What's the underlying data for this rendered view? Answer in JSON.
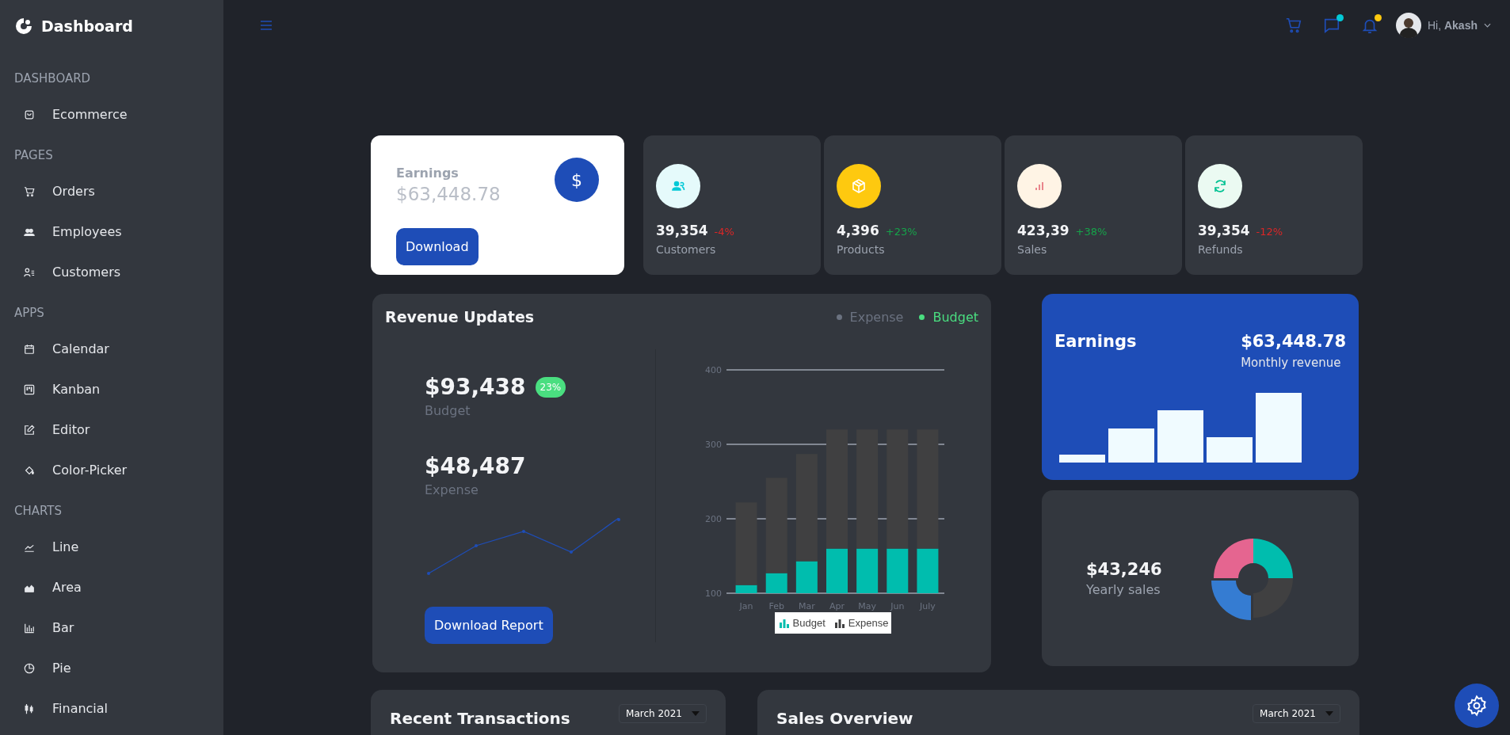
{
  "sidebar": {
    "brand": "Dashboard",
    "sections": [
      {
        "title": "DASHBOARD",
        "items": [
          {
            "label": "Ecommerce",
            "kind": "bag"
          }
        ]
      },
      {
        "title": "PAGES",
        "items": [
          {
            "label": "Orders",
            "kind": "cart"
          },
          {
            "label": "Employees",
            "kind": "users"
          },
          {
            "label": "Customers",
            "kind": "userlist"
          }
        ]
      },
      {
        "title": "APPS",
        "items": [
          {
            "label": "Calendar",
            "kind": "calendar"
          },
          {
            "label": "Kanban",
            "kind": "kanban"
          },
          {
            "label": "Editor",
            "kind": "edit"
          },
          {
            "label": "Color-Picker",
            "kind": "bucket"
          }
        ]
      },
      {
        "title": "CHARTS",
        "items": [
          {
            "label": "Line",
            "kind": "line"
          },
          {
            "label": "Area",
            "kind": "area"
          },
          {
            "label": "Bar",
            "kind": "bar"
          },
          {
            "label": "Pie",
            "kind": "pie"
          },
          {
            "label": "Financial",
            "kind": "financial"
          }
        ]
      }
    ]
  },
  "topbar": {
    "actions": [
      {
        "kind": "cart"
      },
      {
        "kind": "chat",
        "color": "#03c9d7"
      },
      {
        "kind": "bell",
        "color": "#fec90f"
      }
    ],
    "user": {
      "greeting": "Hi,",
      "name": "Akash"
    }
  },
  "earnings_card": {
    "title": "Earnings",
    "amount": "$63,448.78",
    "symbol": "$",
    "button": "Download"
  },
  "stats": [
    {
      "kind": "customers",
      "color": "#e5fafb",
      "value": "39,354",
      "change": {
        "text": "-4%",
        "color": "#dc2626"
      },
      "label": "Customers"
    },
    {
      "kind": "products",
      "color": "#fec90f",
      "value": "4,396",
      "change": {
        "text": "+23%",
        "color": "#16a34a"
      },
      "label": "Products"
    },
    {
      "kind": "sales",
      "color": "#fff4e5",
      "value": "423,39",
      "change": {
        "text": "+38%",
        "color": "#16a34a"
      },
      "label": "Sales"
    },
    {
      "kind": "refunds",
      "color": "#ebfaf2",
      "value": "39,354",
      "change": {
        "text": "-12%",
        "color": "#dc2626"
      },
      "label": "Refunds"
    }
  ],
  "revenue": {
    "title": "Revenue Updates",
    "legend": [
      {
        "label": "Expense",
        "selected": false
      },
      {
        "label": "Budget",
        "selected": true
      }
    ],
    "budget": {
      "amount": "$93,438",
      "badge": "23%",
      "label": "Budget"
    },
    "expense": {
      "amount": "$48,487",
      "label": "Expense"
    },
    "button": "Download Report",
    "chart_data": {
      "type": "bar",
      "stacked": true,
      "legend": "bottom",
      "categories": [
        "Jan",
        "Feb",
        "Mar",
        "Apr",
        "May",
        "Jun",
        "July"
      ],
      "ylim": [
        100,
        400
      ],
      "yticks": [
        100,
        200,
        300,
        400
      ],
      "series": [
        {
          "name": "Budget",
          "color": "#00bdae",
          "values": [
            111,
            127,
            143,
            160,
            160,
            160,
            160
          ]
        },
        {
          "name": "Expense",
          "color": "#404041",
          "values": [
            111,
            128,
            144,
            160,
            160,
            160,
            160
          ]
        }
      ]
    }
  },
  "earnings_panel": {
    "title": "Earnings",
    "amount": "$63,448.78",
    "caption": "Monthly revenue"
  },
  "yearly": {
    "amount": "$43,246",
    "caption": "Yearly sales"
  },
  "bottom_cards": [
    {
      "title": "Recent Transactions",
      "dropdown": "March 2021"
    },
    {
      "title": "Sales Overview",
      "dropdown": "March 2021"
    }
  ]
}
